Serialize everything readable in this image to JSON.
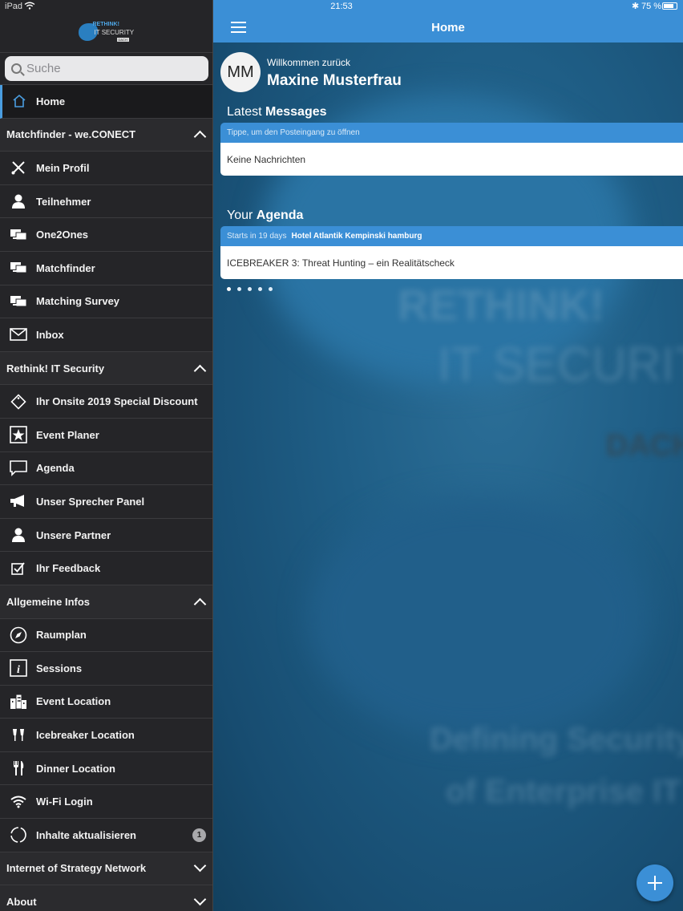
{
  "status_bar": {
    "device": "iPad",
    "time": "21:53",
    "bluetooth": "✱",
    "battery": "75 %"
  },
  "brand": {
    "logo_line1": "RETHINK!",
    "logo_line2": "IT SECURITY",
    "logo_tag": "DACH"
  },
  "search": {
    "placeholder": "Suche"
  },
  "sidebar": {
    "home": {
      "label": "Home",
      "icon": "home-icon"
    },
    "sections": [
      {
        "title": "Matchfinder - we.CONECT",
        "expanded": true,
        "items": [
          {
            "label": "Mein Profil",
            "icon": "tools-icon"
          },
          {
            "label": "Teilnehmer",
            "icon": "person-icon"
          },
          {
            "label": "One2Ones",
            "icon": "screens-icon"
          },
          {
            "label": "Matchfinder",
            "icon": "screens-icon"
          },
          {
            "label": "Matching Survey",
            "icon": "screens-icon"
          },
          {
            "label": "Inbox",
            "icon": "envelope-icon"
          }
        ]
      },
      {
        "title": "Rethink! IT Security",
        "expanded": true,
        "items": [
          {
            "label": "Ihr Onsite 2019 Special Discount",
            "icon": "ticket-icon"
          },
          {
            "label": "Event Planer",
            "icon": "star-icon"
          },
          {
            "label": "Agenda",
            "icon": "chat-icon"
          },
          {
            "label": "Unser Sprecher Panel",
            "icon": "megaphone-icon"
          },
          {
            "label": "Unsere Partner",
            "icon": "person-icon"
          },
          {
            "label": "Ihr Feedback",
            "icon": "checkbox-icon"
          }
        ]
      },
      {
        "title": "Allgemeine Infos",
        "expanded": true,
        "items": [
          {
            "label": "Raumplan",
            "icon": "compass-icon"
          },
          {
            "label": "Sessions",
            "icon": "info-icon"
          },
          {
            "label": "Event Location",
            "icon": "buildings-icon"
          },
          {
            "label": "Icebreaker Location",
            "icon": "glasses-icon"
          },
          {
            "label": "Dinner Location",
            "icon": "cutlery-icon"
          },
          {
            "label": "Wi-Fi Login",
            "icon": "wifi-icon"
          },
          {
            "label": "Inhalte aktualisieren",
            "icon": "refresh-icon",
            "badge": "1"
          }
        ]
      },
      {
        "title": "Internet of Strategy Network",
        "expanded": false,
        "items": []
      },
      {
        "title": "About",
        "expanded": false,
        "items": []
      }
    ]
  },
  "header": {
    "title": "Home"
  },
  "user": {
    "initials": "MM",
    "welcome": "Willkommen zurück",
    "name": "Maxine Musterfrau"
  },
  "messages": {
    "title_light": "Latest ",
    "title_bold": "Messages",
    "hint": "Tippe, um den Posteingang zu öffnen",
    "body": "Keine Nachrichten"
  },
  "agenda": {
    "title_light": "Your ",
    "title_bold": "Agenda",
    "starts": "Starts in 19 days",
    "location": "Hotel Atlantik Kempinski hamburg",
    "body": "ICEBREAKER 3: Threat Hunting – ein Realitätscheck"
  },
  "pager": {
    "count": 5,
    "active": 0
  },
  "background_text": {
    "line1": "RETHINK!",
    "line2": "IT SECURITY",
    "line3": "DACH",
    "line4": "Defining Security",
    "line5": "of Enterprise IT"
  },
  "colors": {
    "accent": "#3b8fd6",
    "sidebar_bg": "#252528",
    "main_bg": "#1f5e86"
  }
}
